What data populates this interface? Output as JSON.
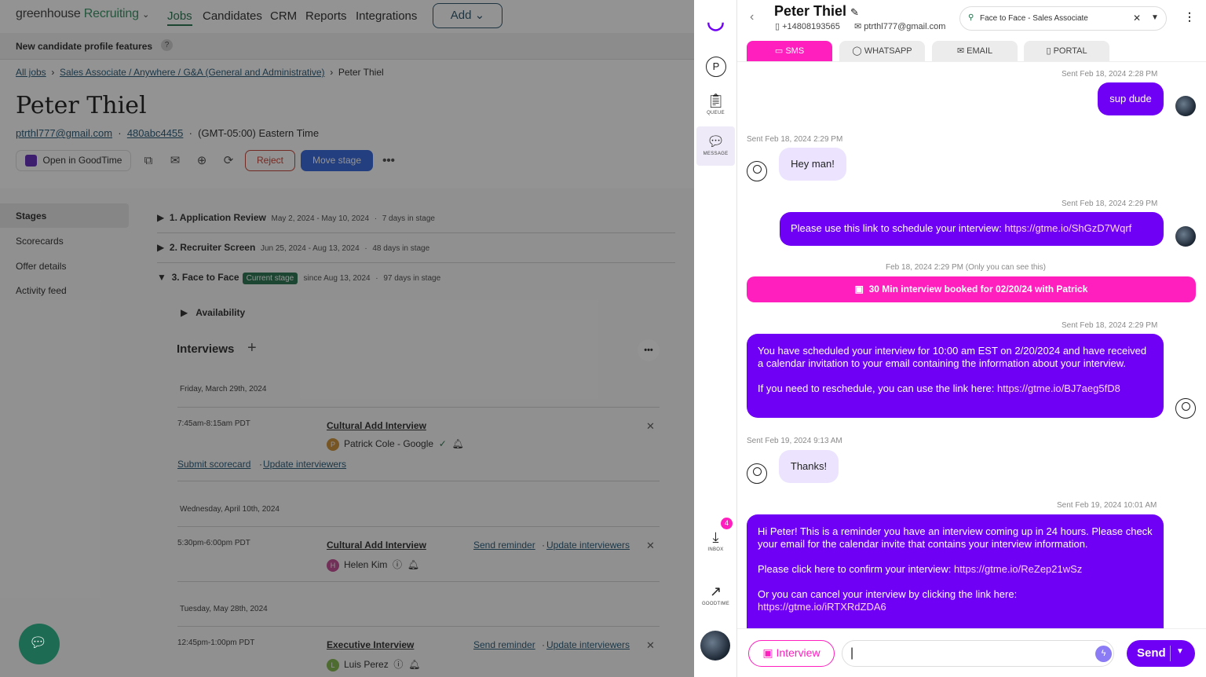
{
  "nav": {
    "logo_main": "greenhouse",
    "logo_sub": "Recruiting",
    "links": [
      "Jobs",
      "Candidates",
      "CRM",
      "Reports",
      "Integrations"
    ],
    "add": "Add"
  },
  "banner": "New candidate profile features",
  "breadcrumb": {
    "all_jobs": "All jobs",
    "job": "Sales Associate / Anywhere / G&A (General and Administrative)",
    "current": "Peter Thiel"
  },
  "candidate": {
    "name": "Peter Thiel",
    "email": "ptrthl777@gmail.com",
    "id": "480abc4455",
    "tz": "(GMT-05:00) Eastern Time"
  },
  "actions": {
    "goodtime": "Open in GoodTime",
    "reject": "Reject",
    "move": "Move stage"
  },
  "side": [
    "Stages",
    "Scorecards",
    "Offer details",
    "Activity feed"
  ],
  "stages": [
    {
      "title": "1. Application Review",
      "dates": "May 2, 2024 - May 10, 2024",
      "days": "7 days in stage"
    },
    {
      "title": "2. Recruiter Screen",
      "dates": "Jun 25, 2024 - Aug 13, 2024",
      "days": "48 days in stage"
    },
    {
      "title": "3. Face to Face",
      "badge": "Current stage",
      "dates": "since Aug 13, 2024",
      "days": "97 days in stage"
    }
  ],
  "availability": "Availability",
  "interviews_heading": "Interviews",
  "interviews": [
    {
      "date": "Friday, March 29th, 2024",
      "time": "7:45am-8:15am PDT",
      "title": "Cultural Add Interview",
      "person": "Patrick Cole - Google",
      "initial": "P",
      "color": "#c98a2b",
      "links": [
        "Submit scorecard",
        "Update interviewers"
      ]
    },
    {
      "date": "Wednesday, April 10th, 2024",
      "time": "5:30pm-6:00pm PDT",
      "title": "Cultural Add Interview",
      "person": "Helen Kim",
      "initial": "H",
      "color": "#c0408f",
      "links": [
        "Send reminder",
        "Update interviewers"
      ]
    },
    {
      "date": "Tuesday, May 28th, 2024",
      "time": "12:45pm-1:00pm PDT",
      "title": "Executive Interview",
      "person": "Luis Perez",
      "initial": "L",
      "color": "#7cb342",
      "links": [
        "Send reminder",
        "Update interviewers"
      ]
    }
  ],
  "rail": {
    "avatar_letter": "P",
    "queue": "QUEUE",
    "message": "MESSAGE",
    "inbox": "INBOX",
    "inbox_count": "4",
    "goodtime": "GOODTIME"
  },
  "panel": {
    "name": "Peter Thiel",
    "phone": "+14808193565",
    "email": "ptrthl777@gmail.com",
    "stage": "Face to Face - Sales Associate",
    "tabs": [
      "SMS",
      "WHATSAPP",
      "EMAIL",
      "PORTAL"
    ],
    "messages": {
      "ts1": "Sent Feb 18, 2024 2:28 PM",
      "m1": "sup dude",
      "ts2": "Sent Feb 18, 2024 2:29 PM",
      "m2": "Hey man!",
      "ts3": "Sent Feb 18, 2024 2:29 PM",
      "m3": "Please use this link to schedule your interview:",
      "m3_link": "https://gtme.io/ShGzD7Wqrf",
      "ts4": "Feb 18, 2024 2:29 PM (Only you can see this)",
      "booked": "30 Min interview booked for 02/20/24 with Patrick",
      "ts5": "Sent Feb 18, 2024 2:29 PM",
      "m5a": "You have scheduled your interview for 10:00 am EST on 2/20/2024 and have received a calendar invitation to your email containing the  information about your interview.",
      "m5b": "If you need to reschedule, you can use the link here:",
      "m5_link": "https://gtme.io/BJ7aeg5fD8",
      "ts6": "Sent Feb 19, 2024 9:13 AM",
      "m6": "Thanks!",
      "ts7": "Sent Feb 19, 2024 10:01 AM",
      "m7a": "Hi Peter! This is a reminder you have an interview coming up in 24 hours. Please check your email for the calendar invite that contains your interview information.",
      "m7b": "Please click here to confirm your interview:",
      "m7b_link": "https://gtme.io/ReZep21wSz",
      "m7c": "Or you can cancel your interview by clicking the link here:",
      "m7c_link": "https://gtme.io/iRTXRdZDA6"
    },
    "compose": {
      "interview": "Interview",
      "send": "Send"
    }
  },
  "colors": {
    "brand_pink": "#ff1fbf",
    "brand_purple": "#6f00f5",
    "gh_green": "#1d6b46"
  }
}
